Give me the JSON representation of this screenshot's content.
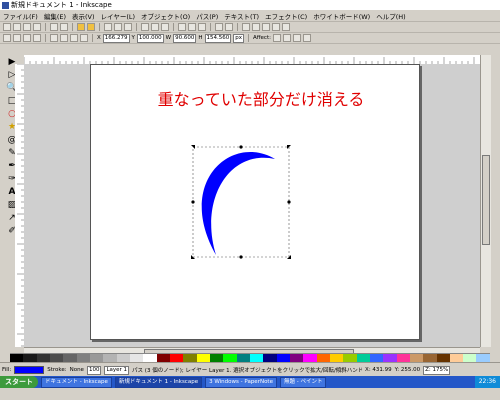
{
  "window": {
    "title": "新規ドキュメント 1 - Inkscape"
  },
  "menu": [
    "ファイル(F)",
    "編集(E)",
    "表示(V)",
    "レイヤー(L)",
    "オブジェクト(O)",
    "パス(P)",
    "テキスト(T)",
    "エフェクト(C)",
    "ホワイトボード(W)",
    "ヘルプ(H)"
  ],
  "tool_controls": {
    "x_label": "X",
    "x_value": "166.279",
    "y_label": "Y",
    "y_value": "100.000",
    "w_label": "W",
    "w_value": "90.600",
    "h_label": "H",
    "h_value": "154.560",
    "unit": "px",
    "affect_label": "Affect:"
  },
  "canvas": {
    "caption": "重なっていた部分だけ消える",
    "shape_fill": "#0000ff",
    "caption_color": "#e00000"
  },
  "palette": [
    "#000000",
    "#1a1a1a",
    "#333333",
    "#4d4d4d",
    "#666666",
    "#808080",
    "#999999",
    "#b3b3b3",
    "#cccccc",
    "#e6e6e6",
    "#ffffff",
    "#800000",
    "#ff0000",
    "#808000",
    "#ffff00",
    "#008000",
    "#00ff00",
    "#008080",
    "#00ffff",
    "#000080",
    "#0000ff",
    "#800080",
    "#ff00ff",
    "#ff6600",
    "#ffcc00",
    "#99cc00",
    "#00cc99",
    "#3366ff",
    "#9933ff",
    "#ff3399",
    "#cc9966",
    "#996633",
    "#663300",
    "#ffcc99",
    "#ccffcc",
    "#99ccff"
  ],
  "status": {
    "fill_label": "Fill:",
    "stroke_label": "Stroke:",
    "stroke_value": "None",
    "opacity": "100",
    "layer": "Layer 1",
    "message": "パス (3 個のノード); レイヤー Layer 1. 選択オブジェクトをクリックで拡大/回転/傾斜ハンドル切替え.",
    "coords_x": "X: 431.99",
    "coords_y": "Y: 255.00",
    "zoom": "Z: 175%"
  },
  "taskbar": {
    "start": "スタート",
    "tasks": [
      "ドキュメント - Inkscape",
      "新規ドキュメント 1 - Inkscape",
      "3 Windows - PaperNote",
      "無題 - ペイント"
    ],
    "clock": "22:36"
  }
}
